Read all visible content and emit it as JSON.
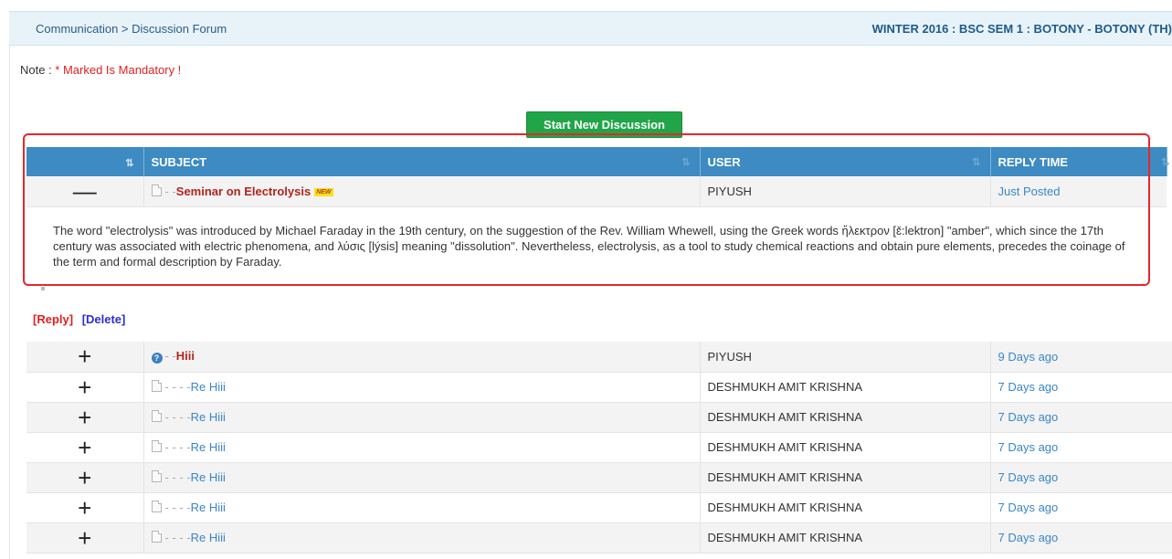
{
  "header": {
    "breadcrumb": "Communication > Discussion Forum",
    "course": "WINTER 2016 : BSC SEM 1 : BOTONY - BOTONY (TH)"
  },
  "note": {
    "label": "Note : ",
    "mandatory": "* Marked Is Mandatory !"
  },
  "start_button": "Start New Discussion",
  "table": {
    "columns": {
      "subject": "SUBJECT",
      "user": "USER",
      "reply_time": "REPLY TIME"
    },
    "expanded": {
      "toggle": "—",
      "prefix": "- -",
      "subject": "Seminar on Electrolysis",
      "badge": "NEW",
      "user": "PIYUSH",
      "time": "Just Posted",
      "description": "The word \"electrolysis\" was introduced by Michael Faraday in the 19th century, on the suggestion of the Rev. William Whewell, using the Greek words ἤλεκτρον [ɛ̌:lektron] \"amber\", which since the 17th century was associated with electric phenomena, and λύσις [lýsis] meaning \"dissolution\". Nevertheless, electrolysis, as a tool to study chemical reactions and obtain pure elements, precedes the coinage of the term and formal description by Faraday."
    }
  },
  "actions": {
    "reply": "[Reply]",
    "delete": "[Delete]"
  },
  "threads": [
    {
      "toggle": "+",
      "icon": "help-icon",
      "prefix": "- -",
      "subject": "Hiii",
      "user": "PIYUSH",
      "time": "9 Days ago",
      "kind": "main"
    },
    {
      "toggle": "+",
      "icon": "doc-icon",
      "prefix": "- - - -",
      "subject": "Re Hiii",
      "user": "DESHMUKH AMIT KRISHNA",
      "time": "7 Days ago",
      "kind": "re"
    },
    {
      "toggle": "+",
      "icon": "doc-icon",
      "prefix": "- - - -",
      "subject": "Re Hiii",
      "user": "DESHMUKH AMIT KRISHNA",
      "time": "7 Days ago",
      "kind": "re"
    },
    {
      "toggle": "+",
      "icon": "doc-icon",
      "prefix": "- - - -",
      "subject": "Re Hiii",
      "user": "DESHMUKH AMIT KRISHNA",
      "time": "7 Days ago",
      "kind": "re"
    },
    {
      "toggle": "+",
      "icon": "doc-icon",
      "prefix": "- - - -",
      "subject": "Re Hiii",
      "user": "DESHMUKH AMIT KRISHNA",
      "time": "7 Days ago",
      "kind": "re"
    },
    {
      "toggle": "+",
      "icon": "doc-icon",
      "prefix": "- - - -",
      "subject": "Re Hiii",
      "user": "DESHMUKH AMIT KRISHNA",
      "time": "7 Days ago",
      "kind": "re"
    },
    {
      "toggle": "+",
      "icon": "doc-icon",
      "prefix": "- - - -",
      "subject": "Re Hiii",
      "user": "DESHMUKH AMIT KRISHNA",
      "time": "7 Days ago",
      "kind": "re"
    }
  ],
  "colors": {
    "header_bg": "#3d8bc2",
    "button": "#21a549",
    "subject_main": "#b1241e",
    "link": "#3a86c8",
    "highlight": "#e8262a"
  }
}
